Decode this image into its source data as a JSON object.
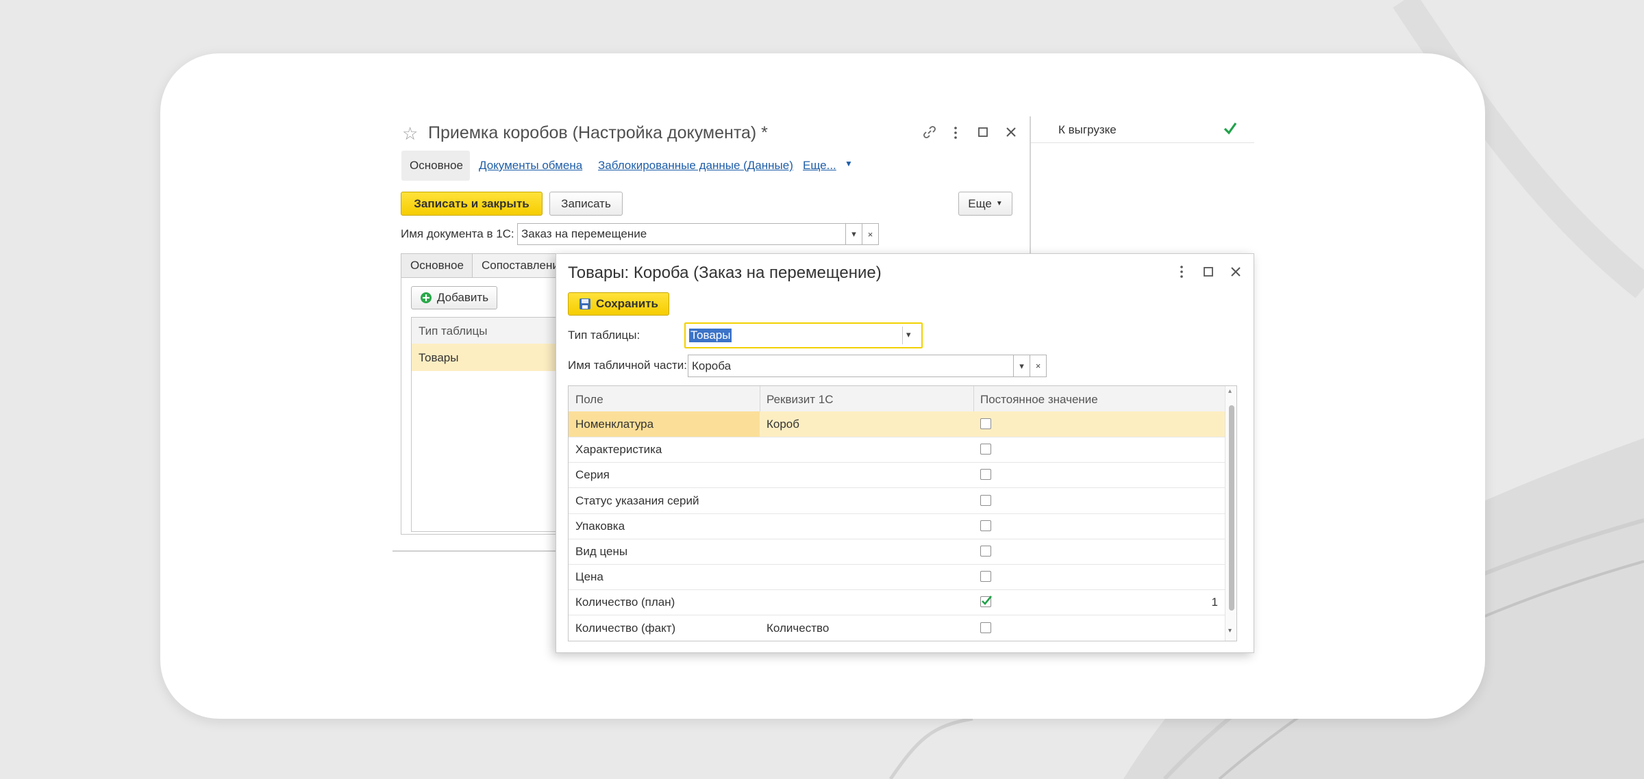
{
  "colors": {
    "accent_yellow": "#f9d400",
    "link": "#1f5ea8",
    "selection": "#fdeec2",
    "check": "#21a24a"
  },
  "main_window": {
    "title": "Приемка коробов (Настройка документа) *",
    "icons": [
      "star-icon",
      "link-icon",
      "more-vertical-icon",
      "maximize-icon",
      "close-icon"
    ],
    "nav": {
      "active": "Основное",
      "links": [
        "Документы обмена",
        "Заблокированные данные (Данные)",
        "Еще..."
      ]
    },
    "toolbar": {
      "save_close_label": "Записать и закрыть",
      "save_label": "Записать",
      "more_label": "Еще"
    },
    "doc_name_label": "Имя документа в 1С:",
    "doc_name_value": "Заказ на перемещение",
    "tabs": [
      "Основное",
      "Сопоставление"
    ],
    "add_button_label": "Добавить",
    "table_header": "Тип таблицы",
    "table_rows": [
      "Товары"
    ]
  },
  "right_panel": {
    "row_label": "К выгрузке",
    "checked": true
  },
  "dialog": {
    "title": "Товары: Короба (Заказ на перемещение)",
    "save_label": "Сохранить",
    "table_type_label": "Тип таблицы:",
    "table_type_value": "Товары",
    "tabular_part_label": "Имя табличной части:",
    "tabular_part_value": "Короба",
    "columns": [
      "Поле",
      "Реквизит 1С",
      "Постоянное значение"
    ],
    "rows": [
      {
        "field": "Номенклатура",
        "attr": "Короб",
        "checked": false,
        "value": ""
      },
      {
        "field": "Характеристика",
        "attr": "",
        "checked": false,
        "value": ""
      },
      {
        "field": "Серия",
        "attr": "",
        "checked": false,
        "value": ""
      },
      {
        "field": "Статус указания серий",
        "attr": "",
        "checked": false,
        "value": ""
      },
      {
        "field": "Упаковка",
        "attr": "",
        "checked": false,
        "value": ""
      },
      {
        "field": "Вид цены",
        "attr": "",
        "checked": false,
        "value": ""
      },
      {
        "field": "Цена",
        "attr": "",
        "checked": false,
        "value": ""
      },
      {
        "field": "Количество (план)",
        "attr": "",
        "checked": true,
        "value": "1"
      },
      {
        "field": "Количество (факт)",
        "attr": "Количество",
        "checked": false,
        "value": ""
      }
    ]
  }
}
